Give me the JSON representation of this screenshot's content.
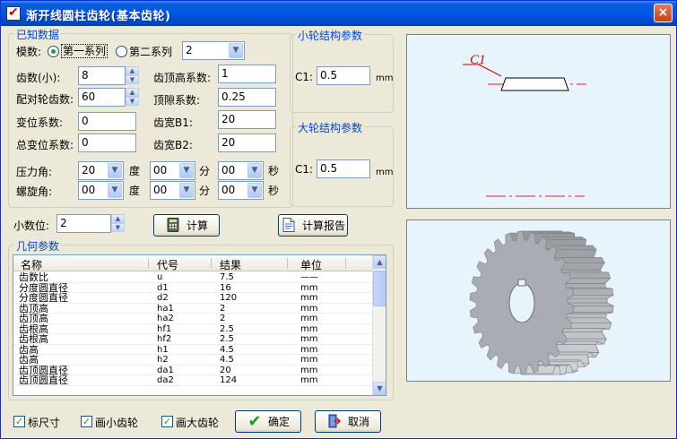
{
  "window": {
    "title": "渐开线圆柱齿轮(基本齿轮)",
    "close": "×"
  },
  "known": {
    "legend": "已知数据",
    "modulus_label": "模数:",
    "series1": "第一系列",
    "series2": "第二系列",
    "modulus_value": "2",
    "teeth_small_label": "齿数(小):",
    "teeth_small": "8",
    "addendum_coef_label": "齿顶高系数:",
    "addendum_coef": "1",
    "mating_teeth_label": "配对轮齿数:",
    "mating_teeth": "60",
    "clearance_coef_label": "顶隙系数:",
    "clearance_coef": "0.25",
    "shift_coef_label": "变位系数:",
    "shift_coef": "0",
    "width_b1_label": "齿宽B1:",
    "width_b1": "20",
    "total_shift_label": "总变位系数:",
    "total_shift": "0",
    "width_b2_label": "齿宽B2:",
    "width_b2": "20",
    "pressure_angle_label": "压力角:",
    "pressure_deg": "20",
    "pressure_min": "00",
    "pressure_sec": "00",
    "helix_angle_label": "螺旋角:",
    "helix_deg": "00",
    "helix_min": "00",
    "helix_sec": "00",
    "deg_unit": "度",
    "min_unit": "分",
    "sec_unit": "秒"
  },
  "small_struct": {
    "legend": "小轮结构参数",
    "c1_label": "C1:",
    "c1_value": "0.5",
    "unit": "mm"
  },
  "large_struct": {
    "legend": "大轮结构参数",
    "c1_label": "C1:",
    "c1_value": "0.5",
    "unit": "mm"
  },
  "decimals": {
    "label": "小数位:",
    "value": "2"
  },
  "buttons": {
    "calc": "计算",
    "report": "计算报告",
    "ok": "确定",
    "cancel": "取消"
  },
  "geometry": {
    "legend": "几何参数",
    "columns": [
      "名称",
      "代号",
      "结果",
      "单位"
    ],
    "rows": [
      [
        "齿数比",
        "u",
        "7.5",
        "——"
      ],
      [
        "分度圆直径",
        "d1",
        "16",
        "mm"
      ],
      [
        "分度圆直径",
        "d2",
        "120",
        "mm"
      ],
      [
        "齿顶高",
        "ha1",
        "2",
        "mm"
      ],
      [
        "齿顶高",
        "ha2",
        "2",
        "mm"
      ],
      [
        "齿根高",
        "hf1",
        "2.5",
        "mm"
      ],
      [
        "齿根高",
        "hf2",
        "2.5",
        "mm"
      ],
      [
        "齿高",
        "h1",
        "4.5",
        "mm"
      ],
      [
        "齿高",
        "h2",
        "4.5",
        "mm"
      ],
      [
        "齿顶圆直径",
        "da1",
        "20",
        "mm"
      ],
      [
        "齿顶圆直径",
        "da2",
        "124",
        "mm"
      ]
    ]
  },
  "options": {
    "mark_dims": "标尺寸",
    "draw_small": "画小齿轮",
    "draw_large": "画大齿轮"
  },
  "preview": {
    "c1_mark": "C1"
  },
  "colors": {
    "title_blue": "#0058e6",
    "legend_blue": "#0046d5",
    "preview_bg": "#e8f4fb",
    "gear_gray": "#a9adb3"
  }
}
